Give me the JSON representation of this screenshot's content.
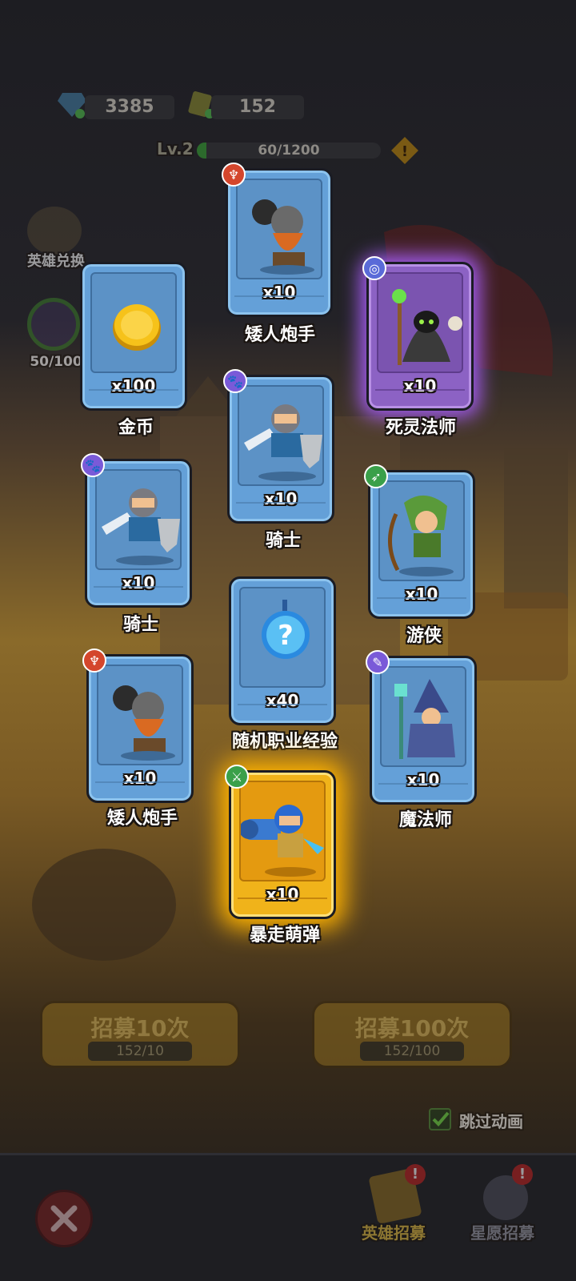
{
  "currency": {
    "gems": "3385",
    "tickets": "152"
  },
  "level": {
    "label": "Lv.2",
    "progress_text": "60/1200",
    "progress": 0.05
  },
  "side": {
    "exchange_label": "英雄兑换",
    "star_count": "50/100"
  },
  "cards": [
    {
      "name": "矮人炮手",
      "count": "x10",
      "rarity": "blue",
      "badge": "red"
    },
    {
      "name": "金币",
      "count": "x100",
      "rarity": "blue",
      "badge": ""
    },
    {
      "name": "死灵法师",
      "count": "x10",
      "rarity": "purple",
      "badge": "blue"
    },
    {
      "name": "骑士",
      "count": "x10",
      "rarity": "blue",
      "badge": "purple"
    },
    {
      "name": "骑士",
      "count": "x10",
      "rarity": "blue",
      "badge": "purple"
    },
    {
      "name": "游侠",
      "count": "x10",
      "rarity": "blue",
      "badge": "green"
    },
    {
      "name": "随机职业经验",
      "count": "x40",
      "rarity": "blue",
      "badge": ""
    },
    {
      "name": "矮人炮手",
      "count": "x10",
      "rarity": "blue",
      "badge": "red"
    },
    {
      "name": "魔法师",
      "count": "x10",
      "rarity": "blue",
      "badge": "purple"
    },
    {
      "name": "暴走萌弹",
      "count": "x10",
      "rarity": "gold",
      "badge": "green"
    }
  ],
  "recruit": {
    "ten": {
      "label": "招募10次",
      "cost": "152/10"
    },
    "hundred": {
      "label": "招募100次",
      "cost": "152/100"
    },
    "skip_label": "跳过动画"
  },
  "bottom_nav": {
    "hero_recruit": "英雄招募",
    "star_recruit": "星愿招募"
  },
  "colors": {
    "blue_card": "#64a0d8",
    "purple_card": "#8c62c4",
    "gold_card": "#f0b31a"
  }
}
